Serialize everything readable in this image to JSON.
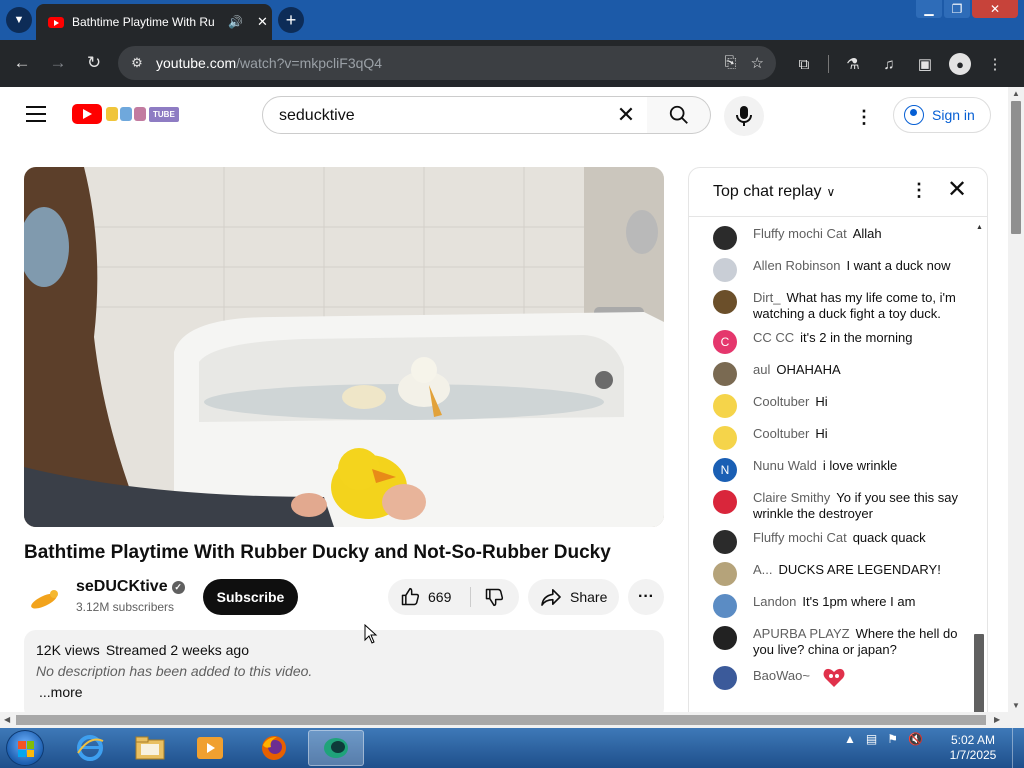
{
  "browser": {
    "tab_title": "Bathtime Playtime With Ru",
    "url_host": "youtube.com",
    "url_path": "/watch?v=mkpcliF3qQ4"
  },
  "masthead": {
    "search_query": "seducktive",
    "signin_label": "Sign in"
  },
  "video": {
    "title": "Bathtime Playtime With Rubber Ducky and Not-So-Rubber Ducky",
    "channel_name": "seDUCKtive",
    "subscribers": "3.12M subscribers",
    "subscribe_label": "Subscribe",
    "like_count": "669",
    "share_label": "Share",
    "views": "12K views",
    "streamed": "Streamed 2 weeks ago",
    "description": "No description has been added to this video.",
    "more_label": "...more"
  },
  "chat": {
    "header": "Top chat replay",
    "messages": [
      {
        "author": "Fluffy mochi Cat",
        "text": "Allah",
        "avatar_color": "#2b2b2b",
        "avatar_letter": ""
      },
      {
        "author": "Allen Robinson",
        "text": "I want a duck now",
        "avatar_color": "#c9ced6",
        "avatar_letter": ""
      },
      {
        "author": "Dirt_",
        "text": "What has my life come to, i'm watching a duck fight a toy duck.",
        "avatar_color": "#6b4f2a",
        "avatar_letter": ""
      },
      {
        "author": "CC CC",
        "text": "it's 2 in the morning",
        "avatar_color": "#e5376d",
        "avatar_letter": "C"
      },
      {
        "author": "aul",
        "text": "OHAHAHA",
        "avatar_color": "#7a6a52",
        "avatar_letter": ""
      },
      {
        "author": "Cooltuber",
        "text": "Hi",
        "avatar_color": "#f5d44a",
        "avatar_letter": ""
      },
      {
        "author": "Cooltuber",
        "text": "Hi",
        "avatar_color": "#f5d44a",
        "avatar_letter": ""
      },
      {
        "author": "Nunu Wald",
        "text": "i love wrinkle",
        "avatar_color": "#1a5fb4",
        "avatar_letter": "N"
      },
      {
        "author": "Claire Smithy",
        "text": "Yo if you see this say wrinkle the destroyer",
        "avatar_color": "#d9263b",
        "avatar_letter": ""
      },
      {
        "author": "Fluffy mochi Cat",
        "text": "quack quack",
        "avatar_color": "#2b2b2b",
        "avatar_letter": ""
      },
      {
        "author": "A...",
        "text": "DUCKS ARE LEGENDARY!",
        "avatar_color": "#b5a37a",
        "avatar_letter": ""
      },
      {
        "author": "Landon",
        "text": "It's 1pm where I am",
        "avatar_color": "#5b8cc4",
        "avatar_letter": ""
      },
      {
        "author": "APURBA PLAYZ",
        "text": "Where the hell do you live? china or japan?",
        "avatar_color": "#222222",
        "avatar_letter": ""
      },
      {
        "author": "BaoWao~",
        "text": "",
        "avatar_color": "#3b5a9a",
        "avatar_letter": ""
      }
    ]
  },
  "taskbar": {
    "time": "5:02 AM",
    "date": "1/7/2025"
  },
  "colors": {
    "youtube_red": "#ff0000",
    "link_blue": "#065fd4",
    "browser_dark": "#24272a",
    "titlebar_blue": "#1c5aa8"
  },
  "icons": [
    "youtube-favicon",
    "audio-icon",
    "close-icon",
    "new-tab-icon",
    "back-icon",
    "forward-icon",
    "reload-icon",
    "site-info-icon",
    "install-icon",
    "bookmark-star-icon",
    "extensions-icon",
    "labs-icon",
    "media-icon",
    "sidebar-icon",
    "profile-icon",
    "more-vert-icon",
    "hamburger-icon",
    "search-icon",
    "mic-icon",
    "like-icon",
    "dislike-icon",
    "share-icon",
    "verified-icon"
  ]
}
